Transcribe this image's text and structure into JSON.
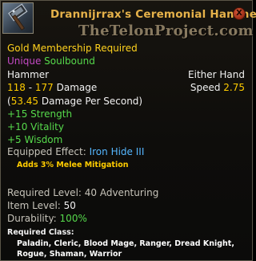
{
  "item": {
    "title": "Drannijrrax's Ceremonial Hammer",
    "watermark": "TheTelonProject.com",
    "close_label": "X",
    "membership": "Gold Membership Required",
    "rarity": "Unique",
    "binding": "Soulbound",
    "type": "Hammer",
    "slot": "Either Hand",
    "damage_min": "118",
    "damage_sep": " - ",
    "damage_max": "177",
    "damage_label": " Damage",
    "speed_label": "Speed ",
    "speed_value": "2.75",
    "dps_open": "(",
    "dps_value": "53.45",
    "dps_label": " Damage Per Second)",
    "stats": [
      "+15 Strength",
      "+10 Vitality",
      "+5 Wisdom"
    ],
    "equipped_effect_label": "Equipped Effect: ",
    "equipped_effect_value": "Iron Hide III",
    "equipped_effect_desc": "Adds 3% Melee Mitigation",
    "required_level": "Required Level: 40 Adventuring",
    "item_level_label": "Item Level: ",
    "item_level_value": "50",
    "durability_label": "Durability: ",
    "durability_value": "100%",
    "required_class_label": "Required Class:",
    "required_class_lines": [
      "Paladin, Cleric, Blood Mage, Ranger, Dread Knight,",
      "Rogue, Shaman, Warrior"
    ]
  },
  "icons": {
    "item_icon": "hammer-icon",
    "close_icon": "close-icon"
  },
  "colors": {
    "title": "#e6b24a",
    "membership": "#ffd21e",
    "rarity": "#c54ac5",
    "binding": "#56d94b",
    "stat_bonus": "#56d94b",
    "effect_value": "#55b7ff",
    "effect_desc": "#ffcc00",
    "durability_value": "#56d94b"
  }
}
